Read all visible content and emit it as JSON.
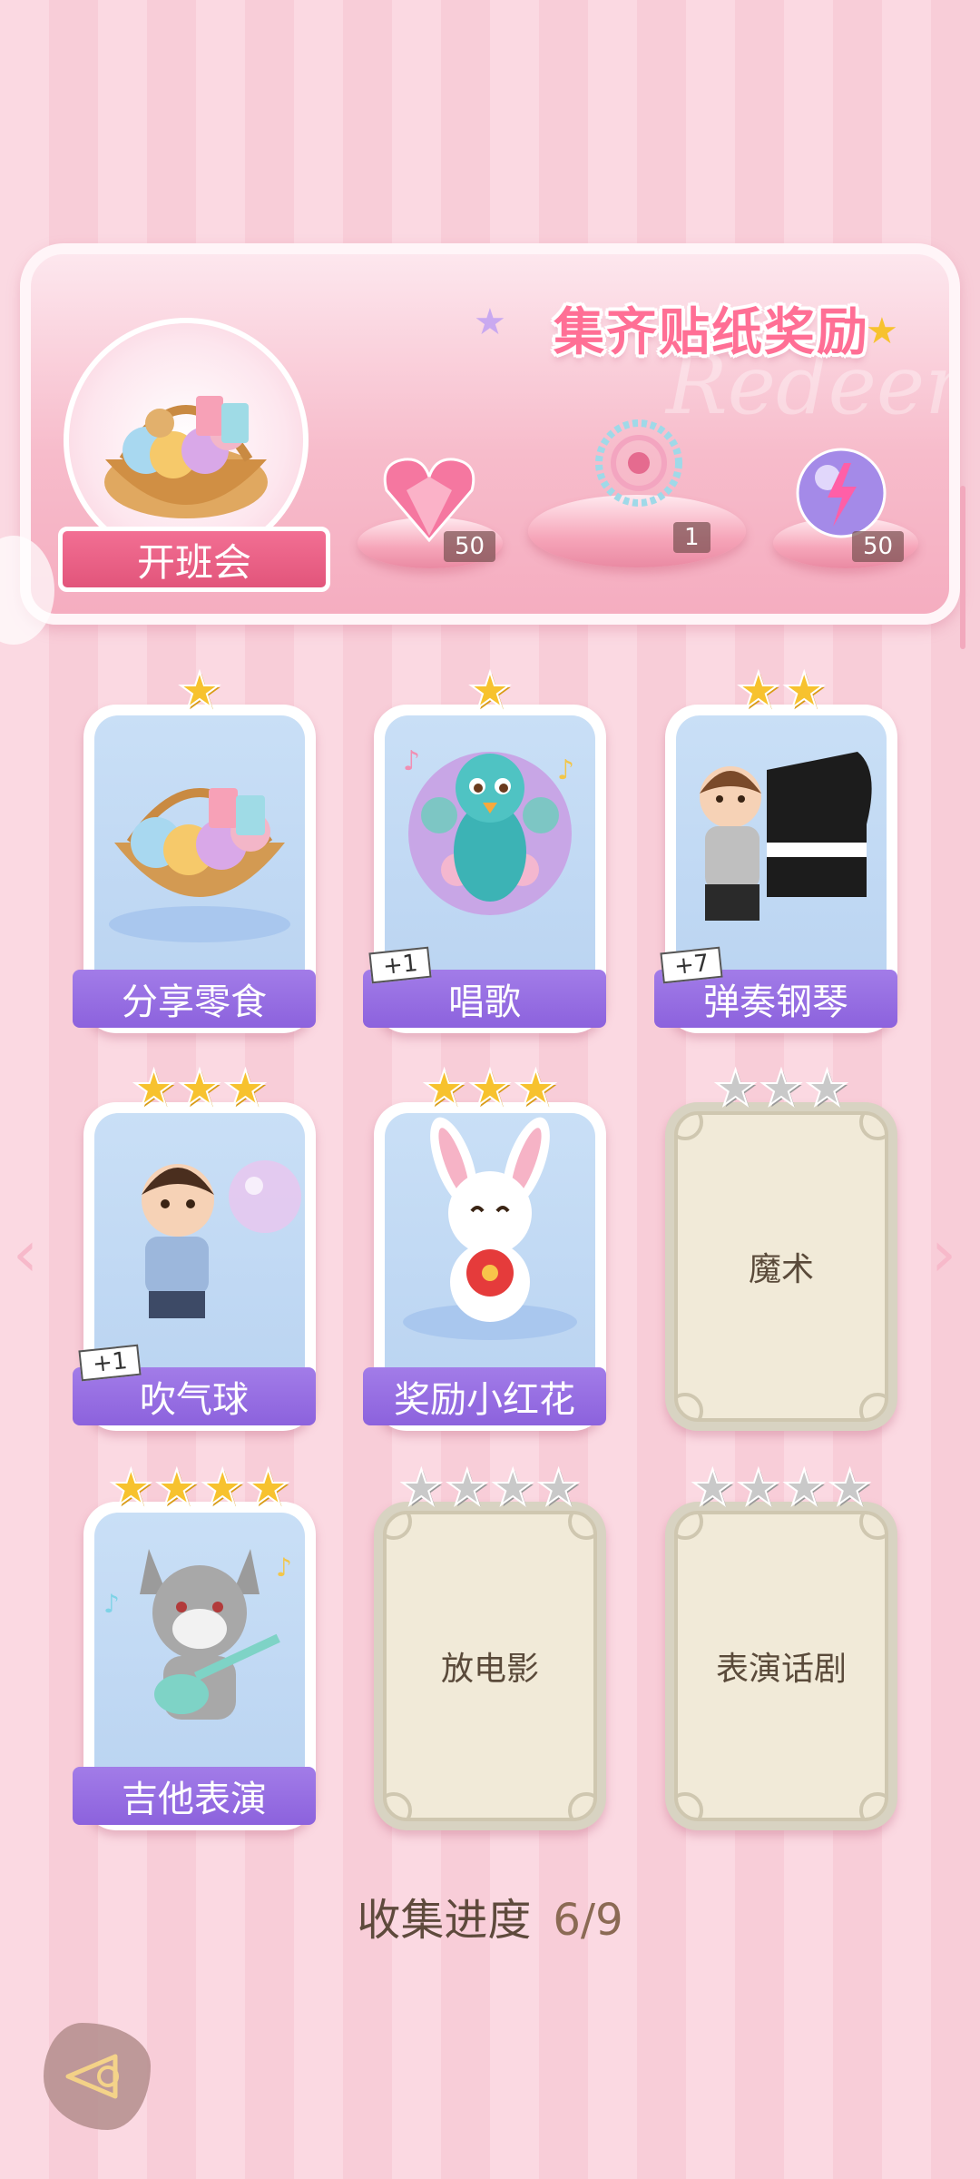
{
  "banner": {
    "title": "集齐贴纸奖励",
    "watermark": "Redeem",
    "main_reward_label": "开班会",
    "rewards": [
      {
        "icon": "pink-heart-gem-icon",
        "count": "50"
      },
      {
        "icon": "ornament-brooch-icon",
        "count": "1"
      },
      {
        "icon": "purple-energy-orb-icon",
        "count": "50"
      }
    ]
  },
  "cards": [
    {
      "name": "分享零食",
      "stars": 1,
      "max_stars": 1,
      "unlocked": true,
      "plus": ""
    },
    {
      "name": "唱歌",
      "stars": 1,
      "max_stars": 1,
      "unlocked": true,
      "plus": "+1"
    },
    {
      "name": "弹奏钢琴",
      "stars": 2,
      "max_stars": 2,
      "unlocked": true,
      "plus": "+7"
    },
    {
      "name": "吹气球",
      "stars": 3,
      "max_stars": 3,
      "unlocked": true,
      "plus": "+1"
    },
    {
      "name": "奖励小红花",
      "stars": 3,
      "max_stars": 3,
      "unlocked": true,
      "plus": ""
    },
    {
      "name": "魔术",
      "stars": 0,
      "max_stars": 3,
      "unlocked": false,
      "plus": ""
    },
    {
      "name": "吉他表演",
      "stars": 4,
      "max_stars": 4,
      "unlocked": true,
      "plus": ""
    },
    {
      "name": "放电影",
      "stars": 0,
      "max_stars": 4,
      "unlocked": false,
      "plus": ""
    },
    {
      "name": "表演话剧",
      "stars": 0,
      "max_stars": 4,
      "unlocked": false,
      "plus": ""
    }
  ],
  "progress": {
    "label": "收集进度",
    "value": "6/9"
  },
  "nav": {
    "prev": "‹",
    "next": "›"
  },
  "colors": {
    "label_purple": "#9a72e4",
    "star_gold": "#f7c22e",
    "pink_accent": "#ff6f95"
  }
}
